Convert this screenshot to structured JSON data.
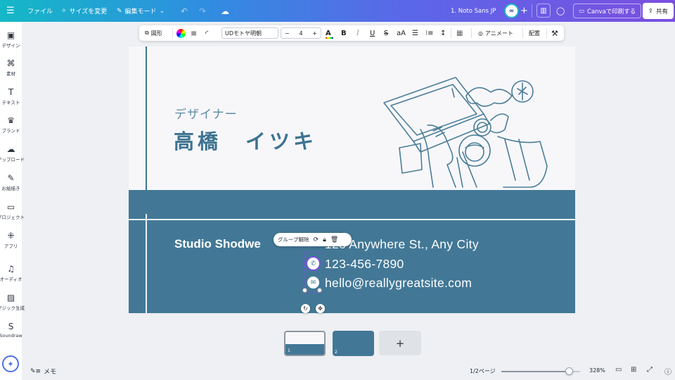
{
  "topbar": {
    "menu_icon": "hamburger-icon",
    "file": "ファイル",
    "resize": "サイズを変更",
    "edit_mode": "編集モード",
    "doc_title": "1. Noto Sans JP",
    "print": "Canvaで印刷する",
    "share": "共有"
  },
  "sidebar": {
    "items": [
      {
        "icon": "design-icon",
        "glyph": "▣",
        "label": "デザイン"
      },
      {
        "icon": "elements-icon",
        "glyph": "⌘",
        "label": "素材"
      },
      {
        "icon": "text-icon",
        "glyph": "T",
        "label": "テキスト"
      },
      {
        "icon": "brand-icon",
        "glyph": "♛",
        "label": "ブランド"
      },
      {
        "icon": "upload-icon",
        "glyph": "☁",
        "label": "アップロード"
      },
      {
        "icon": "draw-icon",
        "glyph": "✎",
        "label": "お絵描き"
      },
      {
        "icon": "projects-icon",
        "glyph": "▭",
        "label": "プロジェクト"
      },
      {
        "icon": "apps-icon",
        "glyph": "⁜",
        "label": "アプリ"
      },
      {
        "icon": "audio-icon",
        "glyph": "♫",
        "label": "オーディオ"
      },
      {
        "icon": "magic-gen-icon",
        "glyph": "▨",
        "label": "マジック生成"
      },
      {
        "icon": "soundraw-icon",
        "glyph": "S",
        "label": "Soundraw"
      }
    ]
  },
  "toolbar": {
    "shape": "図形",
    "font": "UDモトヤ明朝",
    "size_minus": "−",
    "font_size": "4",
    "size_plus": "+",
    "text_color": "A",
    "bold": "B",
    "italic": "I",
    "underline": "U",
    "strike": "S",
    "case": "aA",
    "animate": "アニメート",
    "position": "配置"
  },
  "card": {
    "role": "デザイナー",
    "name": "高橋　イツキ",
    "studio": "Studio Shodwe",
    "address": "123 Anywhere St., Any City",
    "phone": "123-456-7890",
    "email": "hello@reallygreatsite.com",
    "colors": {
      "primary": "#427896",
      "background": "#f7f7fa"
    }
  },
  "selection_pill": {
    "ungroup": "グループ解除"
  },
  "pages": {
    "thumb1_num": "1",
    "thumb2_num": "2",
    "add": "+"
  },
  "bottom": {
    "memo": "メモ",
    "page_info": "1/2ページ",
    "zoom_value": "328%",
    "zoom_fraction": 0.86
  }
}
